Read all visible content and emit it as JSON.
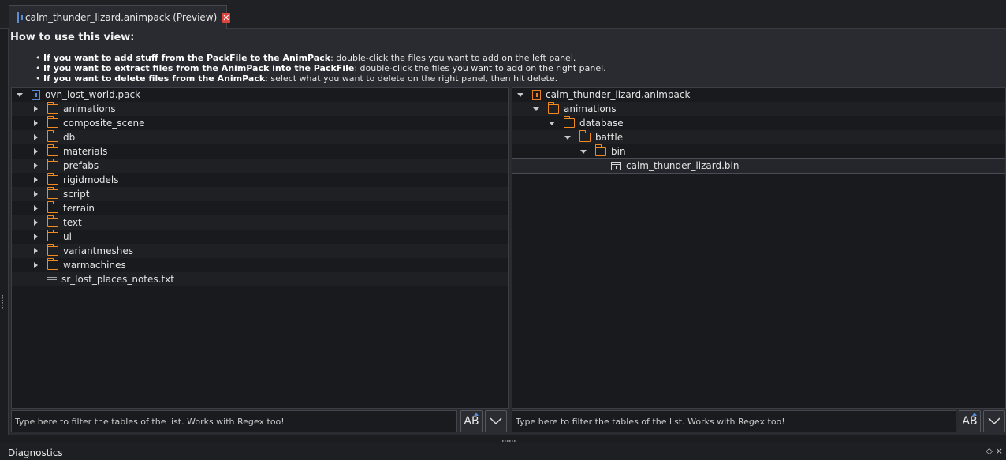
{
  "tab": {
    "title": "calm_thunder_lizard.animpack (Preview)",
    "close_glyph": "✕"
  },
  "help": {
    "title": "How to use this view:",
    "lines": [
      {
        "bold": "If you want to add stuff from the PackFile to the AnimPack",
        "rest": ": double-click the files you want to add on the left panel."
      },
      {
        "bold": "If you want to extract files from the AnimPack into the PackFile",
        "rest": ": double-click the files you want to add on the right panel."
      },
      {
        "bold": "If you want to delete files from the AnimPack",
        "rest": ": select what you want to delete on the right panel, then hit delete."
      }
    ]
  },
  "left_tree": [
    {
      "label": "ovn_lost_world.pack",
      "depth": 0,
      "arrow": "down",
      "icon": "pack-icon"
    },
    {
      "label": "animations",
      "depth": 1,
      "arrow": "right",
      "icon": "folder-icon"
    },
    {
      "label": "composite_scene",
      "depth": 1,
      "arrow": "right",
      "icon": "folder-icon"
    },
    {
      "label": "db",
      "depth": 1,
      "arrow": "right",
      "icon": "folder-icon"
    },
    {
      "label": "materials",
      "depth": 1,
      "arrow": "right",
      "icon": "folder-icon"
    },
    {
      "label": "prefabs",
      "depth": 1,
      "arrow": "right",
      "icon": "folder-icon"
    },
    {
      "label": "rigidmodels",
      "depth": 1,
      "arrow": "right",
      "icon": "folder-icon"
    },
    {
      "label": "script",
      "depth": 1,
      "arrow": "right",
      "icon": "folder-icon"
    },
    {
      "label": "terrain",
      "depth": 1,
      "arrow": "right",
      "icon": "folder-icon"
    },
    {
      "label": "text",
      "depth": 1,
      "arrow": "right",
      "icon": "folder-icon"
    },
    {
      "label": "ui",
      "depth": 1,
      "arrow": "right",
      "icon": "folder-icon"
    },
    {
      "label": "variantmeshes",
      "depth": 1,
      "arrow": "right",
      "icon": "folder-icon"
    },
    {
      "label": "warmachines",
      "depth": 1,
      "arrow": "right",
      "icon": "folder-icon"
    },
    {
      "label": "sr_lost_places_notes.txt",
      "depth": 1,
      "arrow": "none",
      "icon": "text-icon"
    }
  ],
  "right_tree": [
    {
      "label": "calm_thunder_lizard.animpack",
      "depth": 0,
      "arrow": "down",
      "icon": "animpack-icon"
    },
    {
      "label": "animations",
      "depth": 1,
      "arrow": "down",
      "icon": "folder-icon"
    },
    {
      "label": "database",
      "depth": 2,
      "arrow": "down",
      "icon": "folder-icon"
    },
    {
      "label": "battle",
      "depth": 3,
      "arrow": "down",
      "icon": "folder-icon"
    },
    {
      "label": "bin",
      "depth": 4,
      "arrow": "down",
      "icon": "folder-icon"
    },
    {
      "label": "calm_thunder_lizard.bin",
      "depth": 5,
      "arrow": "none",
      "icon": "bin-icon",
      "selected": true
    }
  ],
  "left_filter": {
    "placeholder": "Type here to filter the tables of the list. Works with Regex too!",
    "case_label": "AB"
  },
  "right_filter": {
    "placeholder": "Type here to filter the tables of the list. Works with Regex too!",
    "case_label": "AB"
  },
  "diagnostics": {
    "title": "Diagnostics",
    "float_glyph": "◇",
    "close_glyph": "×"
  }
}
